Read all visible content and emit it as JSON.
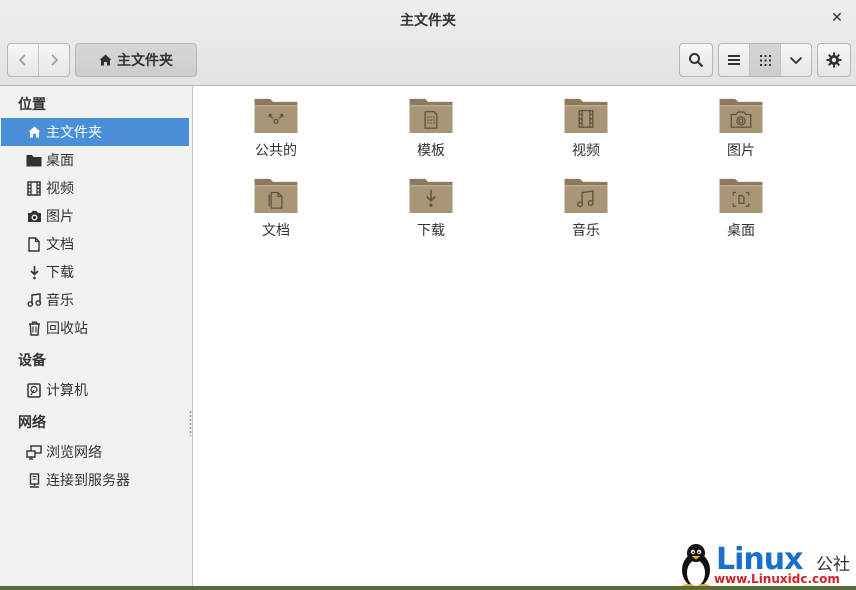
{
  "window": {
    "title": "主文件夹"
  },
  "toolbar": {
    "back_label": "<",
    "forward_label": ">",
    "path_label": "主文件夹",
    "icons": {
      "home": "home-icon",
      "search": "search-icon",
      "list": "list-view-icon",
      "grid": "grid-view-icon",
      "dropdown": "chevron-down-icon",
      "settings": "gear-icon"
    }
  },
  "sidebar": {
    "places_title": "位置",
    "places": [
      {
        "label": "主文件夹",
        "icon": "home-icon",
        "selected": true
      },
      {
        "label": "桌面",
        "icon": "folder-icon"
      },
      {
        "label": "视频",
        "icon": "film-icon"
      },
      {
        "label": "图片",
        "icon": "camera-icon"
      },
      {
        "label": "文档",
        "icon": "document-icon"
      },
      {
        "label": "下载",
        "icon": "download-icon"
      },
      {
        "label": "音乐",
        "icon": "music-icon"
      },
      {
        "label": "回收站",
        "icon": "trash-icon"
      }
    ],
    "devices_title": "设备",
    "devices": [
      {
        "label": "计算机",
        "icon": "drive-icon"
      }
    ],
    "network_title": "网络",
    "network": [
      {
        "label": "浏览网络",
        "icon": "network-icon"
      },
      {
        "label": "连接到服务器",
        "icon": "server-icon"
      }
    ]
  },
  "content": {
    "items": [
      {
        "label": "公共的",
        "icon": "public-folder-icon"
      },
      {
        "label": "模板",
        "icon": "templates-folder-icon"
      },
      {
        "label": "视频",
        "icon": "videos-folder-icon"
      },
      {
        "label": "图片",
        "icon": "pictures-folder-icon"
      },
      {
        "label": "文档",
        "icon": "documents-folder-icon"
      },
      {
        "label": "下载",
        "icon": "downloads-folder-icon"
      },
      {
        "label": "音乐",
        "icon": "music-folder-icon"
      },
      {
        "label": "桌面",
        "icon": "desktop-folder-icon"
      }
    ]
  },
  "watermark": {
    "brand": "Linux",
    "cn": "公社",
    "url": "www.Linuxidc.com"
  },
  "colors": {
    "accent": "#4a90d9",
    "folder": "#a89677",
    "folder_dark": "#8b7a5e"
  }
}
